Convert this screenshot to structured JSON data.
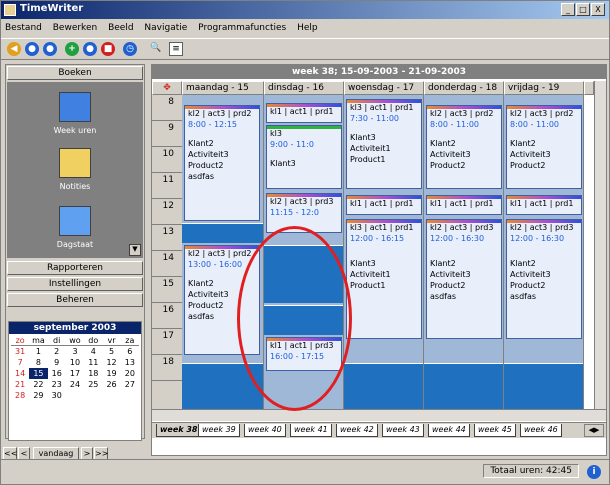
{
  "window": {
    "title": "TimeWriter",
    "buttons": [
      "_",
      "□",
      "X"
    ]
  },
  "menu": [
    "Bestand",
    "Bewerken",
    "Beeld",
    "Navigatie",
    "Programmafuncties",
    "Help"
  ],
  "sidebar": {
    "top_button": "Boeken",
    "icons": [
      {
        "label": "Week uren"
      },
      {
        "label": "Notities"
      },
      {
        "label": "Dagstaat"
      }
    ],
    "buttons": [
      "Rapporteren",
      "Instellingen",
      "Beheren"
    ]
  },
  "calendar": {
    "month": "september 2003",
    "weekdays": [
      "zo",
      "ma",
      "di",
      "wo",
      "do",
      "vr",
      "za"
    ],
    "days": [
      "31",
      "1",
      "2",
      "3",
      "4",
      "5",
      "6",
      "7",
      "8",
      "9",
      "10",
      "11",
      "12",
      "13",
      "14",
      "15",
      "16",
      "17",
      "18",
      "19",
      "20",
      "21",
      "22",
      "23",
      "24",
      "25",
      "26",
      "27",
      "28",
      "29",
      "30",
      "",
      "",
      "",
      ""
    ],
    "today": "15",
    "nav": {
      "prev": "<<",
      "prev1": "<",
      "today_btn": "vandaag",
      "next1": ">",
      "next": ">>"
    }
  },
  "main": {
    "week_title": "week 38; 15-09-2003 - 21-09-2003",
    "days": [
      "maandag - 15",
      "dinsdag - 16",
      "woensdag - 17",
      "donderdag - 18",
      "vrijdag - 19"
    ],
    "hours": [
      "8",
      "9",
      "10",
      "11",
      "12",
      "13",
      "14",
      "15",
      "16",
      "17",
      "18"
    ],
    "events": {
      "mon_a": {
        "head": "kl2 | act3 | prd2",
        "time": "8:00 - 12:15",
        "lines": [
          "Klant2",
          "Activiteit3",
          "Product2",
          "asdfas"
        ]
      },
      "mon_b": {
        "head": "kl2 | act3 | prd2",
        "time": "13:00 - 16:00",
        "lines": [
          "Klant2",
          "Activiteit3",
          "Product2",
          "asdfas"
        ]
      },
      "tue_a": {
        "head": "kl1 | act1 | prd1",
        "time": ""
      },
      "tue_b": {
        "head": "kl3",
        "time": "9:00 - 11:0",
        "lines": [
          "Klant3"
        ]
      },
      "tue_c": {
        "head": "kl2 | act3 | prd3",
        "time": "11:15 - 12:0"
      },
      "tue_d": {
        "head": "kl1 | act1 | prd3",
        "time": "16:00 - 17:15"
      },
      "wed_a": {
        "head": "kl3 | act1 | prd1",
        "time": "7:30 - 11:00",
        "lines": [
          "Klant3",
          "Activiteit1",
          "Product1"
        ]
      },
      "wed_b": {
        "head": "kl1 | act1 | prd1",
        "time": ""
      },
      "wed_c": {
        "head": "kl3 | act1 | prd1",
        "time": "12:00 - 16:15",
        "lines": [
          "Klant3",
          "Activiteit1",
          "Product1"
        ]
      },
      "thu_a": {
        "head": "kl2 | act3 | prd2",
        "time": "8:00 - 11:00",
        "lines": [
          "Klant2",
          "Activiteit3",
          "Product2"
        ]
      },
      "thu_b": {
        "head": "kl1 | act1 | prd1",
        "time": ""
      },
      "thu_c": {
        "head": "kl2 | act3 | prd3",
        "time": "12:00 - 16:30",
        "lines": [
          "Klant2",
          "Activiteit3",
          "Product2",
          "asdfas"
        ]
      },
      "fri_a": {
        "head": "kl2 | act3 | prd2",
        "time": "8:00 - 11:00",
        "lines": [
          "Klant2",
          "Activiteit3",
          "Product2"
        ]
      },
      "fri_b": {
        "head": "kl1 | act1 | prd1",
        "time": ""
      },
      "fri_c": {
        "head": "kl2 | act3 | prd3",
        "time": "12:00 - 16:30",
        "lines": [
          "Klant2",
          "Activiteit3",
          "Product2",
          "asdfas"
        ]
      }
    },
    "tabs": [
      "week 38",
      "week 39",
      "week 40",
      "week 41",
      "week 42",
      "week 43",
      "week 44",
      "week 45",
      "week 46"
    ]
  },
  "status": {
    "total": "Totaal uren: 42:45"
  },
  "colors": {
    "accent": "#0a246a",
    "annotation": "#e02020",
    "event_bg": "#e8eefa",
    "busy": "#2070c0"
  }
}
